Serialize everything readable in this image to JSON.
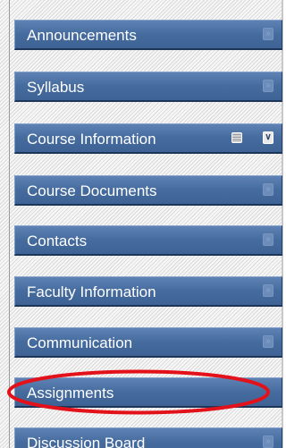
{
  "course_menu": {
    "items": [
      {
        "label": "Announcements",
        "expand_icon": "chevron-down-icon"
      },
      {
        "label": "Syllabus",
        "expand_icon": "chevron-down-icon"
      },
      {
        "label": "Course Information",
        "expand_icon": "chevron-down-icon",
        "has_manage_icon": true,
        "manage_icon": "options-icon"
      },
      {
        "label": "Course Documents",
        "expand_icon": "chevron-down-icon"
      },
      {
        "label": "Contacts",
        "expand_icon": "chevron-down-icon"
      },
      {
        "label": "Faculty Information",
        "expand_icon": "chevron-down-icon"
      },
      {
        "label": "Communication",
        "expand_icon": "chevron-down-icon"
      },
      {
        "label": "Assignments",
        "highlighted": true
      },
      {
        "label": "Discussion Board",
        "expand_icon": "chevron-down-icon"
      }
    ]
  },
  "colors": {
    "menu_button": "#466c9f",
    "menu_text": "#ffffff",
    "highlight_ring": "#e3111a"
  }
}
